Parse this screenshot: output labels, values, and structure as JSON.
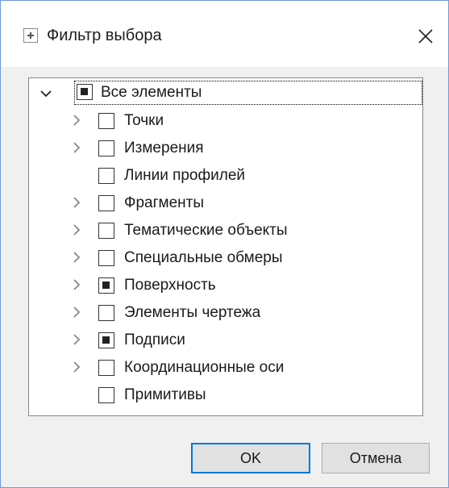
{
  "window": {
    "title": "Фильтр выбора",
    "icon": "dialog-plus-icon",
    "close_icon": "close-icon"
  },
  "tree": {
    "root": {
      "label": "Все элементы",
      "state": "partial",
      "expanded": true
    },
    "items": [
      {
        "label": "Точки",
        "state": "unchecked",
        "has_children": true
      },
      {
        "label": "Измерения",
        "state": "unchecked",
        "has_children": true
      },
      {
        "label": "Линии профилей",
        "state": "unchecked",
        "has_children": false
      },
      {
        "label": "Фрагменты",
        "state": "unchecked",
        "has_children": true
      },
      {
        "label": "Тематические объекты",
        "state": "unchecked",
        "has_children": true
      },
      {
        "label": "Специальные обмеры",
        "state": "unchecked",
        "has_children": true
      },
      {
        "label": "Поверхность",
        "state": "partial",
        "has_children": true
      },
      {
        "label": "Элементы чертежа",
        "state": "unchecked",
        "has_children": true
      },
      {
        "label": "Подписи",
        "state": "partial",
        "has_children": true
      },
      {
        "label": "Координационные оси",
        "state": "unchecked",
        "has_children": true
      },
      {
        "label": "Примитивы",
        "state": "unchecked",
        "has_children": false
      }
    ]
  },
  "buttons": {
    "ok": "OK",
    "cancel": "Отмена"
  },
  "colors": {
    "accent": "#0078d7",
    "window_bg": "#f0f0f0",
    "border": "#828790"
  }
}
